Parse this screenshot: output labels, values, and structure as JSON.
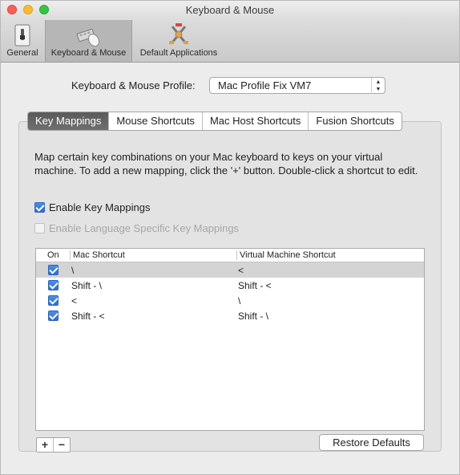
{
  "window": {
    "title": "Keyboard & Mouse"
  },
  "toolbar": {
    "items": [
      {
        "label": "General",
        "icon": "general-switch-icon"
      },
      {
        "label": "Keyboard & Mouse",
        "icon": "keyboard-mouse-icon",
        "selected": true
      },
      {
        "label": "Default Applications",
        "icon": "default-applications-icon"
      }
    ]
  },
  "profile": {
    "label": "Keyboard & Mouse Profile:",
    "value": "Mac Profile Fix VM7"
  },
  "tabs": [
    {
      "label": "Key Mappings",
      "active": true
    },
    {
      "label": "Mouse Shortcuts"
    },
    {
      "label": "Mac Host Shortcuts"
    },
    {
      "label": "Fusion Shortcuts"
    }
  ],
  "description": "Map certain key combinations on your Mac keyboard to keys on your virtual machine. To add a new mapping, click the '+' button. Double-click a shortcut to edit.",
  "options": {
    "enable_key_mappings": {
      "label": "Enable Key Mappings",
      "checked": true
    },
    "enable_language_specific": {
      "label": "Enable Language Specific Key Mappings",
      "checked": false,
      "disabled": true
    }
  },
  "table": {
    "columns": [
      "On",
      "Mac Shortcut",
      "Virtual Machine Shortcut"
    ],
    "rows": [
      {
        "on": true,
        "mac": "\\",
        "vm": "<",
        "selected": true
      },
      {
        "on": true,
        "mac": "Shift - \\",
        "vm": "Shift - <"
      },
      {
        "on": true,
        "mac": "<",
        "vm": "\\"
      },
      {
        "on": true,
        "mac": "Shift - <",
        "vm": "Shift - \\"
      }
    ]
  },
  "buttons": {
    "add": "+",
    "remove": "−",
    "restore_defaults": "Restore Defaults"
  },
  "colors": {
    "accent": "#2a6fd6",
    "active_tab": "#5b5b5b"
  }
}
